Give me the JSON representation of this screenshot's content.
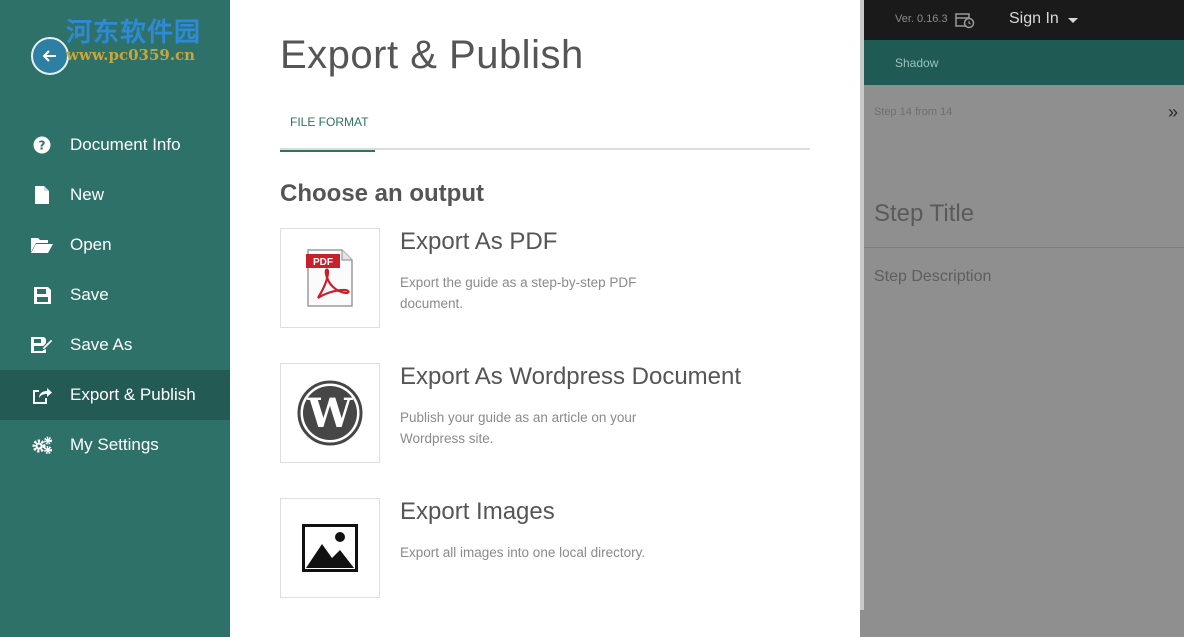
{
  "background": {
    "version": "Ver. 0.16.3",
    "sign_in": "Sign In",
    "toolbar_tab": "Shadow",
    "step_count": "Step 14 from 14",
    "step_title": "Step Title",
    "step_description": "Step Description"
  },
  "watermark": {
    "text": "河东软件园",
    "url": "www.pc0359.cn"
  },
  "sidebar": {
    "items": [
      {
        "label": "Document Info",
        "icon": "question-circle-icon"
      },
      {
        "label": "New",
        "icon": "file-icon"
      },
      {
        "label": "Open",
        "icon": "folder-open-icon"
      },
      {
        "label": "Save",
        "icon": "floppy-disk-icon"
      },
      {
        "label": "Save As",
        "icon": "edit-save-icon"
      },
      {
        "label": "Export & Publish",
        "icon": "share-icon",
        "active": true
      },
      {
        "label": "My Settings",
        "icon": "gears-icon"
      }
    ]
  },
  "dialog": {
    "title": "Export & Publish",
    "tabs": [
      {
        "label": "FILE FORMAT",
        "active": true
      }
    ],
    "subheading": "Choose an output",
    "options": [
      {
        "title": "Export As PDF",
        "description": "Export the guide as a step-by-step PDF document.",
        "icon": "pdf-icon"
      },
      {
        "title": "Export As Wordpress Document",
        "description": "Publish your guide as an article on your Wordpress site.",
        "icon": "wordpress-icon"
      },
      {
        "title": "Export Images",
        "description": "Export all images into one local directory.",
        "icon": "image-icon"
      }
    ]
  },
  "colors": {
    "sidebar": "#2e7168",
    "sidebar_active": "#235a53",
    "accent": "#2e7168",
    "overlay": "#8f8f8f"
  }
}
